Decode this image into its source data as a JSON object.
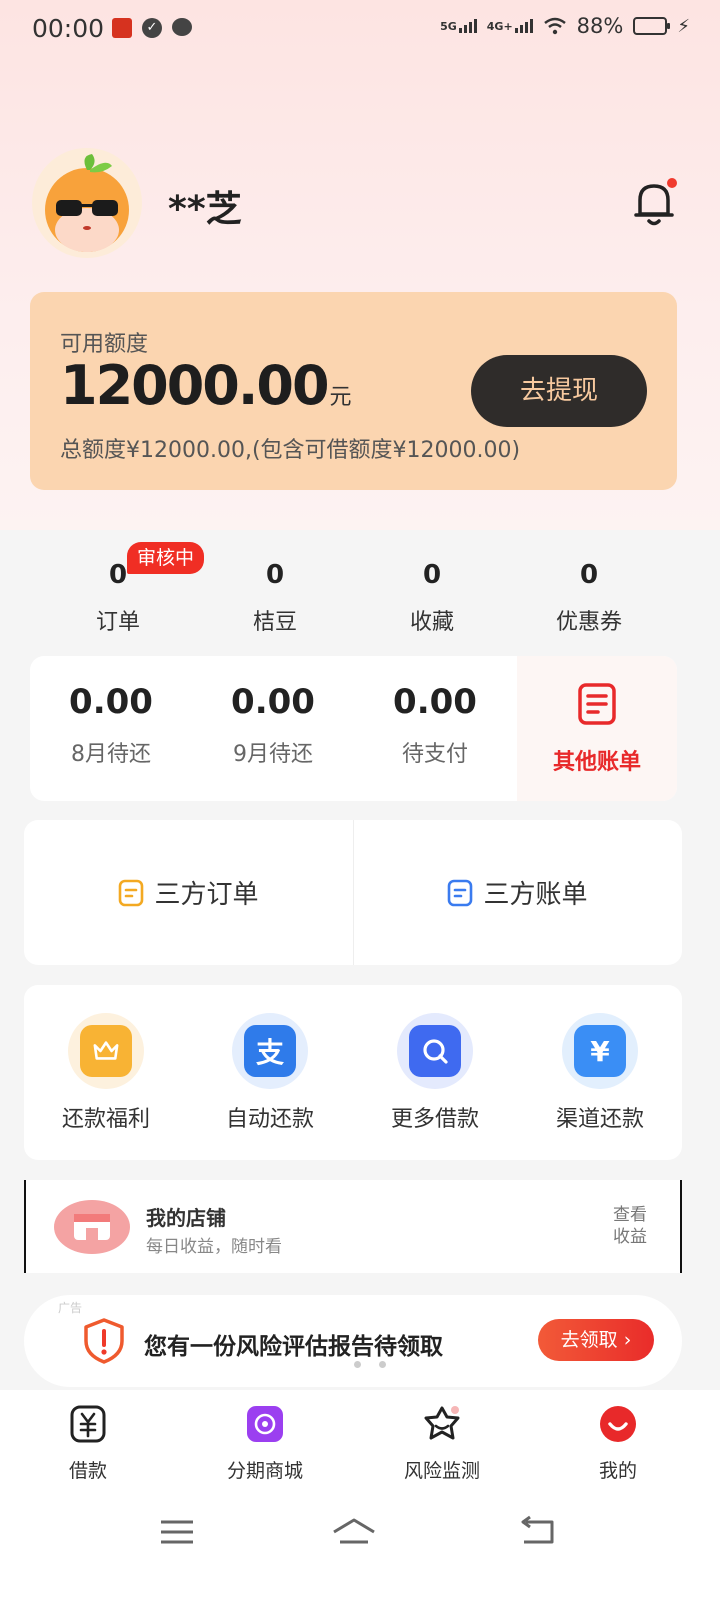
{
  "status_bar": {
    "time": "00:00",
    "signal_1": "5G",
    "signal_2": "4G+",
    "battery": "88%",
    "battery_level": 0.88
  },
  "profile": {
    "username": "**芝"
  },
  "credit": {
    "label": "可用额度",
    "amount": "12000.00",
    "unit": "元",
    "total_text": "总额度¥12000.00,(包含可借额度¥12000.00)",
    "withdraw_label": "去提现"
  },
  "stats": {
    "badge": "审核中",
    "items": [
      {
        "value": "0",
        "label": "订单"
      },
      {
        "value": "0",
        "label": "桔豆"
      },
      {
        "value": "0",
        "label": "收藏"
      },
      {
        "value": "0",
        "label": "优惠券"
      }
    ]
  },
  "bills": {
    "items": [
      {
        "amount": "0.00",
        "label": "8月待还"
      },
      {
        "amount": "0.00",
        "label": "9月待还"
      },
      {
        "amount": "0.00",
        "label": "待支付"
      }
    ],
    "other_label": "其他账单"
  },
  "thirdparty": {
    "orders_label": "三方订单",
    "bills_label": "三方账单"
  },
  "services": {
    "items": [
      {
        "label": "还款福利",
        "icon": "crown-icon",
        "color": "#f8b334"
      },
      {
        "label": "自动还款",
        "icon": "alipay-icon",
        "color": "#2f7bea"
      },
      {
        "label": "更多借款",
        "icon": "search-icon",
        "color": "#3f6af0"
      },
      {
        "label": "渠道还款",
        "icon": "yen-icon",
        "color": "#3a8ef5"
      }
    ]
  },
  "store": {
    "title": "我的店铺",
    "subtitle": "每日收益，随时看",
    "link": "查看收益"
  },
  "ad": {
    "tag": "广告",
    "text": "您有一份风险评估报告待领取",
    "button": "去领取"
  },
  "bottom_nav": {
    "items": [
      {
        "label": "借款"
      },
      {
        "label": "分期商城"
      },
      {
        "label": "风险监测"
      },
      {
        "label": "我的"
      }
    ]
  },
  "colors": {
    "accent_red": "#e8292a",
    "card_peach": "#fbd5b0",
    "button_dark": "#2f2c2a"
  }
}
